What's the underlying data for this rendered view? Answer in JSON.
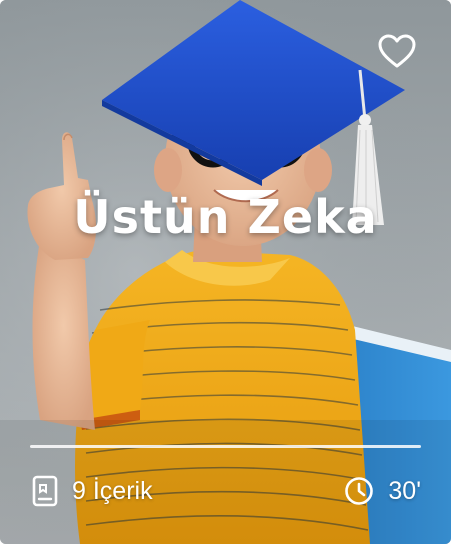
{
  "card": {
    "title": "Üstün Zeka",
    "content_count": "9 İçerik",
    "duration": "30'"
  },
  "icons": {
    "favorite": "heart-outline-icon",
    "content": "book-icon",
    "duration": "clock-icon"
  },
  "colors": {
    "text": "#ffffff",
    "cap": "#1f4fd0",
    "shirt": "#f3b321",
    "book": "#2f8bd4"
  }
}
